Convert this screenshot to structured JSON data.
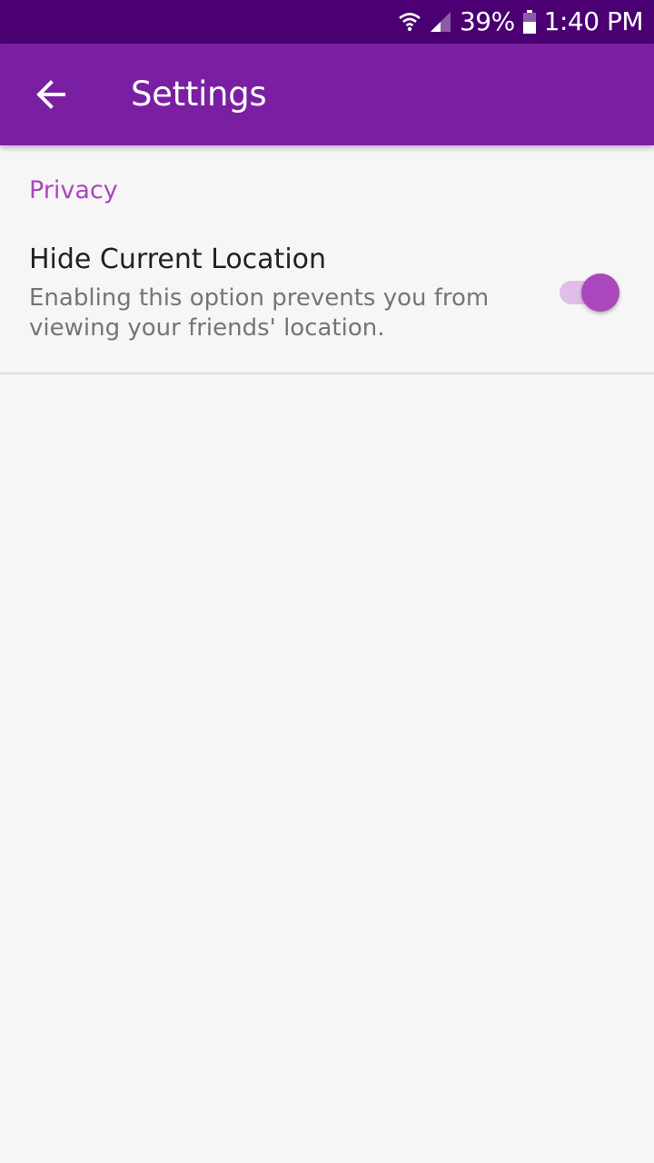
{
  "status_bar": {
    "battery": "39%",
    "time": "1:40 PM",
    "icons": [
      "wifi-icon",
      "signal-icon",
      "battery-icon"
    ]
  },
  "app_bar": {
    "title": "Settings",
    "back_icon": "arrow-back-icon"
  },
  "section": {
    "header": "Privacy",
    "preference": {
      "title": "Hide Current Location",
      "summary": "Enabling this option prevents you from viewing your friends' location.",
      "enabled": true
    }
  },
  "colors": {
    "status_bar": "#4a0073",
    "app_bar": "#7b1fa2",
    "accent": "#ab47bc",
    "toggle_track": "#e1bee7",
    "background": "#f6f6f6"
  }
}
